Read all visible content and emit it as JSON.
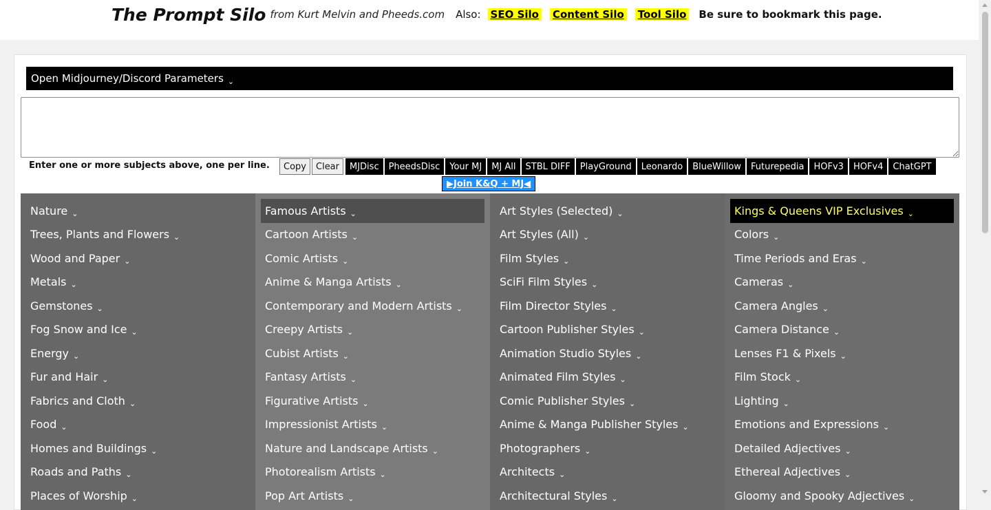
{
  "header": {
    "title": "The Prompt Silo",
    "byline": "from Kurt Melvin and Pheeds.com",
    "also_label": "Also:",
    "links": [
      "SEO Silo",
      "Content Silo",
      "Tool Silo"
    ],
    "bookmark_note": "Be sure to bookmark this page."
  },
  "params_bar": {
    "label": "Open Midjourney/Discord Parameters"
  },
  "prompt_input": {
    "value": "",
    "placeholder": ""
  },
  "hint": "Enter one or more subjects above, one per line.",
  "buttons": {
    "copy": "Copy",
    "clear": "Clear"
  },
  "link_buttons": [
    "MJDisc",
    "PheedsDisc",
    "Your MJ",
    "MJ All",
    "STBL DIFF",
    "PlayGround",
    "Leonardo",
    "BlueWillow",
    "Futurepedia",
    "HOFv3",
    "HOFv4",
    "ChatGPT"
  ],
  "join_button": "▶Join K&Q + MJ◀",
  "chevron": "⌄",
  "columns": [
    {
      "items": [
        "Nature",
        "Trees, Plants and Flowers",
        "Wood and Paper",
        "Metals",
        "Gemstones",
        "Fog Snow and Ice",
        "Energy",
        "Fur and Hair",
        "Fabrics and Cloth",
        "Food",
        "Homes and Buildings",
        "Roads and Paths",
        "Places of Worship"
      ]
    },
    {
      "items": [
        "Famous Artists",
        "Cartoon Artists",
        "Comic Artists",
        "Anime & Manga Artists",
        "Contemporary and Modern Artists",
        "Creepy Artists",
        "Cubist Artists",
        "Fantasy Artists",
        "Figurative Artists",
        "Impressionist Artists",
        "Nature and Landscape Artists",
        "Photorealism Artists",
        "Pop Art Artists"
      ]
    },
    {
      "items": [
        "Art Styles (Selected)",
        "Art Styles (All)",
        "Film Styles",
        "SciFi Film Styles",
        "Film Director Styles",
        "Cartoon Publisher Styles",
        "Animation Studio Styles",
        "Animated Film Styles",
        "Comic Publisher Styles",
        "Anime & Manga Publisher Styles",
        "Photographers",
        "Architects",
        "Architectural Styles"
      ]
    },
    {
      "items": [
        "Kings & Queens VIP Exclusives",
        "Colors",
        "Time Periods and Eras",
        "Cameras",
        "Camera Angles",
        "Camera Distance",
        "Lenses F1 & Pixels",
        "Film Stock",
        "Lighting",
        "Emotions and Expressions",
        "Detailed Adjectives",
        "Ethereal Adjectives",
        "Gloomy and Spooky Adjectives"
      ]
    }
  ],
  "colors": {
    "col1_bg": "#676767",
    "col2_bg": "#7b7b7b",
    "col3_bg": "#686868",
    "col4_bg": "#6d6d6d",
    "highlight_yellow": "#ffff00",
    "join_blue": "#1e90ff"
  }
}
